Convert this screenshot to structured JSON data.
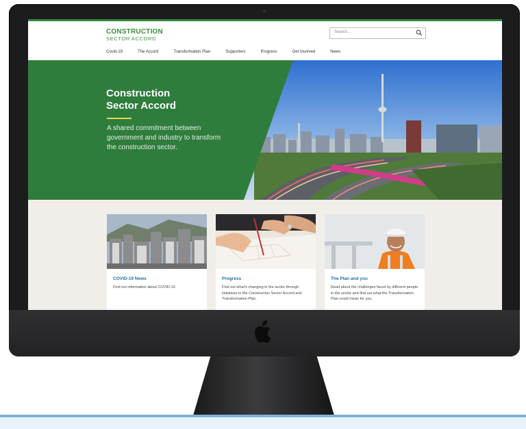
{
  "site": {
    "logo_line1": "CONSTRUCTION",
    "logo_line2": "SECTOR ACCORD"
  },
  "search": {
    "placeholder": "Search..."
  },
  "nav": {
    "items": [
      "Covid-19",
      "The Accord",
      "Transformation Plan",
      "Supporters",
      "Progress",
      "Get Involved",
      "News"
    ]
  },
  "hero": {
    "title": "Construction\nSector Accord",
    "subtitle": "A shared commitment between government and industry to transform the construction sector."
  },
  "cards": [
    {
      "title": "COVID-19 News",
      "description": "Find out information about COVID-19"
    },
    {
      "title": "Progress",
      "description": "Find out what's changing in the sector through initiatives in the Construction Sector Accord and Transformation Plan."
    },
    {
      "title": "The Plan and you",
      "description": "Read about the challenges faced by different people in the sector and find out what the Transformation Plan could mean for you."
    }
  ],
  "colors": {
    "brand_green": "#2f7d3d",
    "link_blue": "#1d6fa5",
    "accent_yellow": "#e5d94d"
  },
  "icons": [
    "search-icon",
    "apple-logo-icon"
  ]
}
